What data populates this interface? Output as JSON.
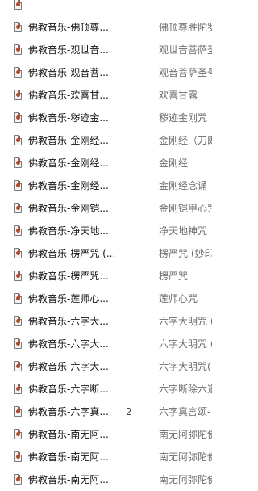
{
  "rows": [
    {
      "name": "",
      "num": "",
      "title": ""
    },
    {
      "name": "佛教音乐-佛顶尊...",
      "num": "",
      "title": "佛顶尊胜陀罗"
    },
    {
      "name": "佛教音乐-观世音...",
      "num": "",
      "title": "观世音菩萨圣"
    },
    {
      "name": "佛教音乐-观音菩...",
      "num": "",
      "title": "观音菩萨圣号"
    },
    {
      "name": "佛教音乐-欢喜甘...",
      "num": "",
      "title": "欢喜甘露"
    },
    {
      "name": "佛教音乐-秽迹金...",
      "num": "",
      "title": "秽迹金刚咒"
    },
    {
      "name": "佛教音乐-金刚经...",
      "num": "",
      "title": "金刚经（刀郎"
    },
    {
      "name": "佛教音乐-金刚经...",
      "num": "",
      "title": "金刚经"
    },
    {
      "name": "佛教音乐-金刚经...",
      "num": "",
      "title": "金刚经念诵"
    },
    {
      "name": "佛教音乐-金刚铠...",
      "num": "",
      "title": "金刚铠甲心咒"
    },
    {
      "name": "佛教音乐-净天地...",
      "num": "",
      "title": "净天地神咒"
    },
    {
      "name": "佛教音乐-楞严咒 (...",
      "num": "",
      "title": "楞严咒 (妙印"
    },
    {
      "name": "佛教音乐-楞严咒...",
      "num": "",
      "title": "楞严咒"
    },
    {
      "name": "佛教音乐-莲师心...",
      "num": "",
      "title": "莲师心咒"
    },
    {
      "name": "佛教音乐-六字大...",
      "num": "",
      "title": "六字大明咒 ("
    },
    {
      "name": "佛教音乐-六字大...",
      "num": "",
      "title": "六字大明咒 ("
    },
    {
      "name": "佛教音乐-六字大...",
      "num": "",
      "title": "六字大明咒("
    },
    {
      "name": "佛教音乐-六字断...",
      "num": "",
      "title": "六字断除六道"
    },
    {
      "name": "佛教音乐-六字真...",
      "num": "2",
      "title": "六字真言颂-"
    },
    {
      "name": "佛教音乐-南无阿...",
      "num": "",
      "title": "南无阿弥陀佛"
    },
    {
      "name": "佛教音乐-南无阿...",
      "num": "",
      "title": "南无阿弥陀佛"
    },
    {
      "name": "佛教音乐-南无阿...",
      "num": "",
      "title": "南无阿弥陀佛"
    }
  ]
}
